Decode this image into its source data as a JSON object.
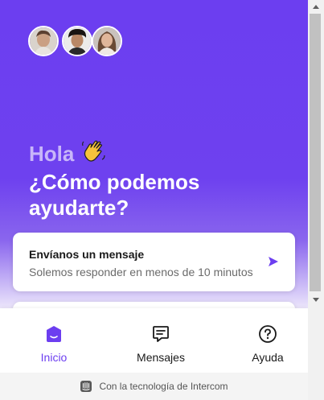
{
  "hero": {
    "greeting": "Hola",
    "greeting_emoji": "👋",
    "question": "¿Cómo podemos ayudarte?",
    "team_avatars": [
      "avatar-1",
      "avatar-2",
      "avatar-3"
    ]
  },
  "message_card": {
    "title": "Envíanos un mensaje",
    "subtitle": "Solemos responder en menos de 10 minutos",
    "icon": "send-icon"
  },
  "tabs": [
    {
      "label": "Inicio",
      "icon": "home-icon",
      "active": true
    },
    {
      "label": "Mensajes",
      "icon": "messages-icon",
      "active": false
    },
    {
      "label": "Ayuda",
      "icon": "help-icon",
      "active": false
    }
  ],
  "footer": {
    "text": "Con la tecnología de Intercom",
    "icon": "intercom-logo-icon"
  },
  "colors": {
    "brand": "#6c3ef0",
    "text": "#1a1a1a",
    "muted": "#6b6b6b"
  }
}
